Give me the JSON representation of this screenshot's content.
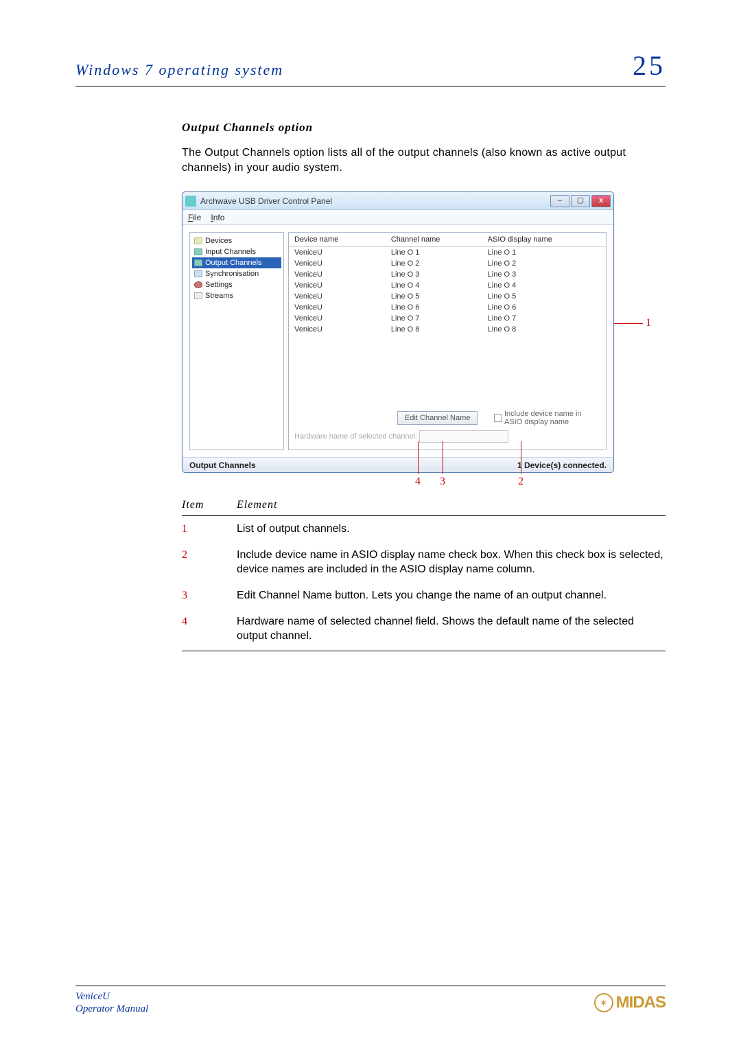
{
  "header": {
    "left": "Windows 7 operating system",
    "right": "25"
  },
  "section": {
    "title": "Output Channels option",
    "intro": "The Output Channels option lists all of the output channels (also known as active output channels) in your audio system."
  },
  "window": {
    "title": "Archwave USB Driver Control Panel",
    "menu": {
      "file": "File",
      "info": "Info"
    },
    "tree": [
      {
        "label": "Devices"
      },
      {
        "label": "Input Channels"
      },
      {
        "label": "Output Channels"
      },
      {
        "label": "Synchronisation"
      },
      {
        "label": "Settings"
      },
      {
        "label": "Streams"
      }
    ],
    "columns": {
      "c1": "Device name",
      "c2": "Channel name",
      "c3": "ASIO display name"
    },
    "rows": [
      {
        "dev": "VeniceU",
        "ch": "Line O 1",
        "asio": "Line O 1"
      },
      {
        "dev": "VeniceU",
        "ch": "Line O 2",
        "asio": "Line O 2"
      },
      {
        "dev": "VeniceU",
        "ch": "Line O 3",
        "asio": "Line O 3"
      },
      {
        "dev": "VeniceU",
        "ch": "Line O 4",
        "asio": "Line O 4"
      },
      {
        "dev": "VeniceU",
        "ch": "Line O 5",
        "asio": "Line O 5"
      },
      {
        "dev": "VeniceU",
        "ch": "Line O 6",
        "asio": "Line O 6"
      },
      {
        "dev": "VeniceU",
        "ch": "Line O 7",
        "asio": "Line O 7"
      },
      {
        "dev": "VeniceU",
        "ch": "Line O 8",
        "asio": "Line O 8"
      }
    ],
    "edit_btn": "Edit Channel Name",
    "checkbox": "Include device name in ASIO display name",
    "hw_label": "Hardware name of selected channel:",
    "status_left": "Output Channels",
    "status_right": "1 Device(s) connected."
  },
  "callouts": {
    "n1": "1",
    "n2": "2",
    "n3": "3",
    "n4": "4"
  },
  "table": {
    "hdr_item": "Item",
    "hdr_elem": "Element",
    "rows": [
      {
        "n": "1",
        "t": "List of output channels."
      },
      {
        "n": "2",
        "t": "Include device name in ASIO display name check box.  When this check box is selected, device names are included in the ASIO display name column."
      },
      {
        "n": "3",
        "t": "Edit Channel Name button.  Lets you change the name of an output channel."
      },
      {
        "n": "4",
        "t": "Hardware name of selected channel field.  Shows the default name of the selected output channel."
      }
    ]
  },
  "footer": {
    "l1": "VeniceU",
    "l2": "Operator Manual",
    "logo": "MIDAS"
  }
}
